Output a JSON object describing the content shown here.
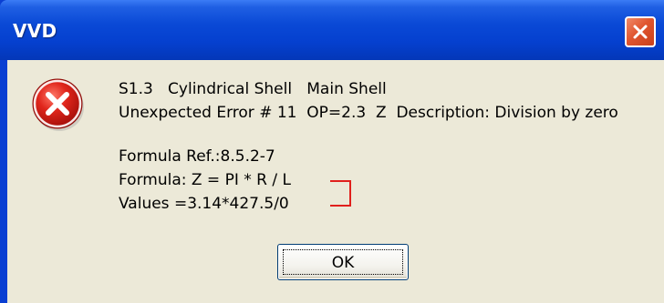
{
  "window": {
    "title": "VVD"
  },
  "icons": {
    "error": "error-icon",
    "close": "close-icon"
  },
  "colors": {
    "titlebar": "#0a49d6",
    "client": "#ece9d8",
    "error_red": "#d81c1c",
    "bracket": "#e0201c",
    "close_button": "#e0552f"
  },
  "message": {
    "line1": "S1.3   Cylindrical Shell   Main Shell",
    "line2": "Unexpected Error # 11  OP=2.3  Z  Description: Division by zero",
    "formula_ref": "Formula Ref.:8.5.2-7",
    "formula": "Formula: Z = PI * R / L",
    "values": "Values =3.14*427.5/0"
  },
  "buttons": {
    "ok_label": "OK"
  }
}
